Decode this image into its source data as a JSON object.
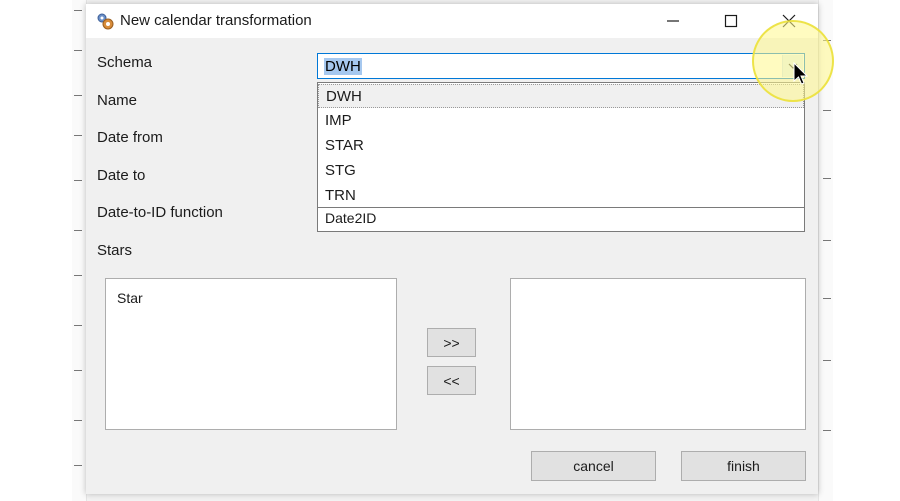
{
  "dialog": {
    "title": "New calendar transformation",
    "icons": {
      "app": "app-gears-icon",
      "minimize": "minimize-icon",
      "maximize": "maximize-icon",
      "close": "close-icon",
      "dropdown": "chevron-down-icon",
      "cursor": "mouse-cursor-icon"
    }
  },
  "form": {
    "schema_label": "Schema",
    "name_label": "Name",
    "date_from_label": "Date from",
    "date_to_label": "Date to",
    "date_to_id_label": "Date-to-ID function",
    "stars_label": "Stars",
    "schema_value": "DWH",
    "date_to_id_value": "Date2ID"
  },
  "schema_dropdown": {
    "options": [
      "DWH",
      "IMP",
      "STAR",
      "STG",
      "TRN"
    ],
    "selected": "DWH"
  },
  "stars": {
    "available": [
      "Star"
    ],
    "selected": []
  },
  "buttons": {
    "add": ">>",
    "remove": "<<",
    "cancel": "cancel",
    "finish": "finish"
  },
  "colors": {
    "selection_highlight": "#a6c8ef",
    "focus_border": "#0078d7",
    "cursor_highlight": "#fff88c"
  }
}
